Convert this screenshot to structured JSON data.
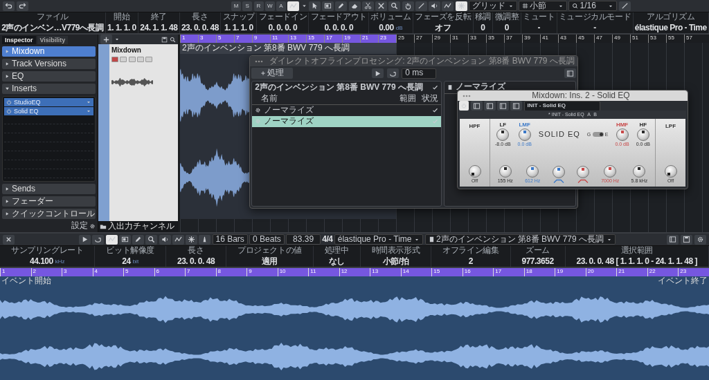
{
  "toolbar": {
    "mode_buttons": [
      "M",
      "S",
      "R",
      "W",
      "A"
    ],
    "grid_mode": "グリッド",
    "grid_type": "小節",
    "quantize": "1/16"
  },
  "info_line": [
    {
      "label": "ファイル",
      "value": "2声のインベン…V779へ長調"
    },
    {
      "label": "開始",
      "value": "1. 1. 1. 0"
    },
    {
      "label": "終了",
      "value": "24. 1. 1. 48"
    },
    {
      "label": "長さ",
      "value": "23. 0. 0. 48"
    },
    {
      "label": "スナップ",
      "value": "1. 1. 1. 0"
    },
    {
      "label": "フェードイン",
      "value": "0. 0. 0. 0"
    },
    {
      "label": "フェードアウト",
      "value": "0. 0. 0. 0"
    },
    {
      "label": "ボリューム",
      "value": "0.00",
      "unit": "dB"
    },
    {
      "label": "フェーズを反転",
      "value": "オフ"
    },
    {
      "label": "移調",
      "value": "0"
    },
    {
      "label": "微調整",
      "value": "0"
    },
    {
      "label": "ミュート",
      "value": "-"
    },
    {
      "label": "ミュージカルモード",
      "value": "-"
    },
    {
      "label": "アルゴリズム",
      "value": "élastique Pro - Time"
    }
  ],
  "inspector": {
    "tabs": [
      {
        "label": "Inspector",
        "selected": true
      },
      {
        "label": "Visibility",
        "selected": false
      }
    ],
    "sections": [
      {
        "label": "Mixdown",
        "expanded": false,
        "kind": "track"
      },
      {
        "label": "Track Versions",
        "expanded": false,
        "kind": "section"
      },
      {
        "label": "EQ",
        "expanded": false,
        "kind": "section"
      },
      {
        "label": "Inserts",
        "expanded": true,
        "kind": "section"
      }
    ],
    "inserts": [
      {
        "name": "StudioEQ"
      },
      {
        "name": "Solid EQ"
      }
    ],
    "bottom_sections": [
      {
        "label": "Sends",
        "expanded": false
      },
      {
        "label": "フェーダー",
        "expanded": false
      },
      {
        "label": "クイックコントロール",
        "expanded": false
      }
    ],
    "settings": "設定"
  },
  "track_list": {
    "tracks": [
      {
        "name": "Mixdown",
        "record_enabled": true
      }
    ],
    "folder": "入出力チャンネル"
  },
  "arrange": {
    "ruler": [
      {
        "label": "1",
        "in_range": true
      },
      {
        "label": "3",
        "in_range": true
      },
      {
        "label": "5",
        "in_range": true
      },
      {
        "label": "7",
        "in_range": true
      },
      {
        "label": "9",
        "in_range": true
      },
      {
        "label": "11",
        "in_range": true
      },
      {
        "label": "13",
        "in_range": true
      },
      {
        "label": "15",
        "in_range": true
      },
      {
        "label": "17",
        "in_range": true
      },
      {
        "label": "19",
        "in_range": true
      },
      {
        "label": "21",
        "in_range": true
      },
      {
        "label": "23",
        "in_range": true
      },
      {
        "label": "25",
        "in_range": false
      },
      {
        "label": "27",
        "in_range": false
      },
      {
        "label": "29",
        "in_range": false
      },
      {
        "label": "31",
        "in_range": false
      },
      {
        "label": "33",
        "in_range": false
      },
      {
        "label": "35",
        "in_range": false
      },
      {
        "label": "37",
        "in_range": false
      },
      {
        "label": "39",
        "in_range": false
      },
      {
        "label": "41",
        "in_range": false
      },
      {
        "label": "43",
        "in_range": false
      },
      {
        "label": "45",
        "in_range": false
      },
      {
        "label": "47",
        "in_range": false
      },
      {
        "label": "49",
        "in_range": false
      },
      {
        "label": "51",
        "in_range": false
      },
      {
        "label": "53",
        "in_range": false
      },
      {
        "label": "55",
        "in_range": false
      },
      {
        "label": "57",
        "in_range": false
      }
    ],
    "event_title": "2声のインベンション 第8番 BWV 779 へ長調"
  },
  "offline_window": {
    "title": "ダイレクトオフラインプロセシング: 2声のインベンション 第8番 BWV 779 へ長調",
    "process_button": "処理",
    "preview_time": "0 ms",
    "clip_title": "2声のインベンション 第8番 BWV 779 へ長調",
    "clip_done": true,
    "columns": [
      "名前",
      "範囲",
      "状況"
    ],
    "rows": [
      {
        "name": "ノーマライズ",
        "done": true,
        "selected": false
      },
      {
        "name": "ノーマライズ",
        "done": true,
        "selected": true
      }
    ],
    "panel_title": "ノーマライズ"
  },
  "eq_window": {
    "title": "Mixdown: Ins. 2 - Solid EQ",
    "power_on": true,
    "preset": "INIT - Solid EQ",
    "inner_preset": "* INIT - Solid EQ",
    "ab": [
      "A",
      "B"
    ],
    "hpf": {
      "label": "HPF",
      "value": "Off"
    },
    "lpf": {
      "label": "LPF",
      "value": "Off"
    },
    "top_row": [
      {
        "kind": "knob",
        "label": "LF",
        "value": "-8.0 dB",
        "color": "#2a2a2a"
      },
      {
        "kind": "knob",
        "label": "LMF",
        "value": "0.0 dB",
        "color": "#3a78c8"
      },
      {
        "kind": "title",
        "label": "SOLID EQ"
      },
      {
        "kind": "switch",
        "left": "G",
        "right": "E",
        "on": true
      },
      {
        "kind": "knob",
        "label": "HMF",
        "value": "0.0 dB",
        "color": "#c84848"
      },
      {
        "kind": "knob",
        "label": "HF",
        "value": "0.0 dB",
        "color": "#2a2a2a"
      }
    ],
    "bottom_row": [
      {
        "kind": "knob",
        "value": "155 Hz",
        "color": "#2a2a2a"
      },
      {
        "kind": "knob",
        "value": "612 Hz",
        "color": "#3a78c8"
      },
      {
        "kind": "q",
        "color": "#3a78c8"
      },
      {
        "kind": "q",
        "color": "#c84848"
      },
      {
        "kind": "knob",
        "value": "7000 Hz",
        "color": "#c84848"
      },
      {
        "kind": "knob",
        "value": "5.8 kHz",
        "color": "#2a2a2a"
      }
    ]
  },
  "sample_editor": {
    "toolbar": {
      "bars": "16 Bars",
      "beats": "0 Beats",
      "tempo": "83.39",
      "signature": "4/4",
      "algorithm": "élastique Pro - Time",
      "clip": "2声のインベンション 第8番 BWV 779 へ長調"
    },
    "info": [
      {
        "label": "サンプリングレート",
        "value": "44.100",
        "unit": "kHz"
      },
      {
        "label": "ビット解像度",
        "value": "24",
        "unit": "bit"
      },
      {
        "label": "長さ",
        "value": "23. 0. 0. 48"
      },
      {
        "label": "プロジェクトの値",
        "value": "適用"
      },
      {
        "label": "処理中",
        "value": "なし"
      },
      {
        "label": "時間表示形式",
        "value": "小節/拍"
      },
      {
        "label": "オフライン編集",
        "value": "2"
      },
      {
        "label": "ズーム",
        "value": "977.3652"
      },
      {
        "label": "選択範囲",
        "value": "23. 0. 0. 48 [ 1. 1. 1. 0 - 24. 1. 1. 48 ]"
      }
    ],
    "ruler": [
      "1",
      "2",
      "3",
      "4",
      "5",
      "6",
      "7",
      "8",
      "9",
      "10",
      "11",
      "12",
      "13",
      "14",
      "15",
      "16",
      "17",
      "18",
      "19",
      "20",
      "21",
      "22",
      "23"
    ],
    "event_start": "イベント開始",
    "event_end": "イベント終了"
  }
}
